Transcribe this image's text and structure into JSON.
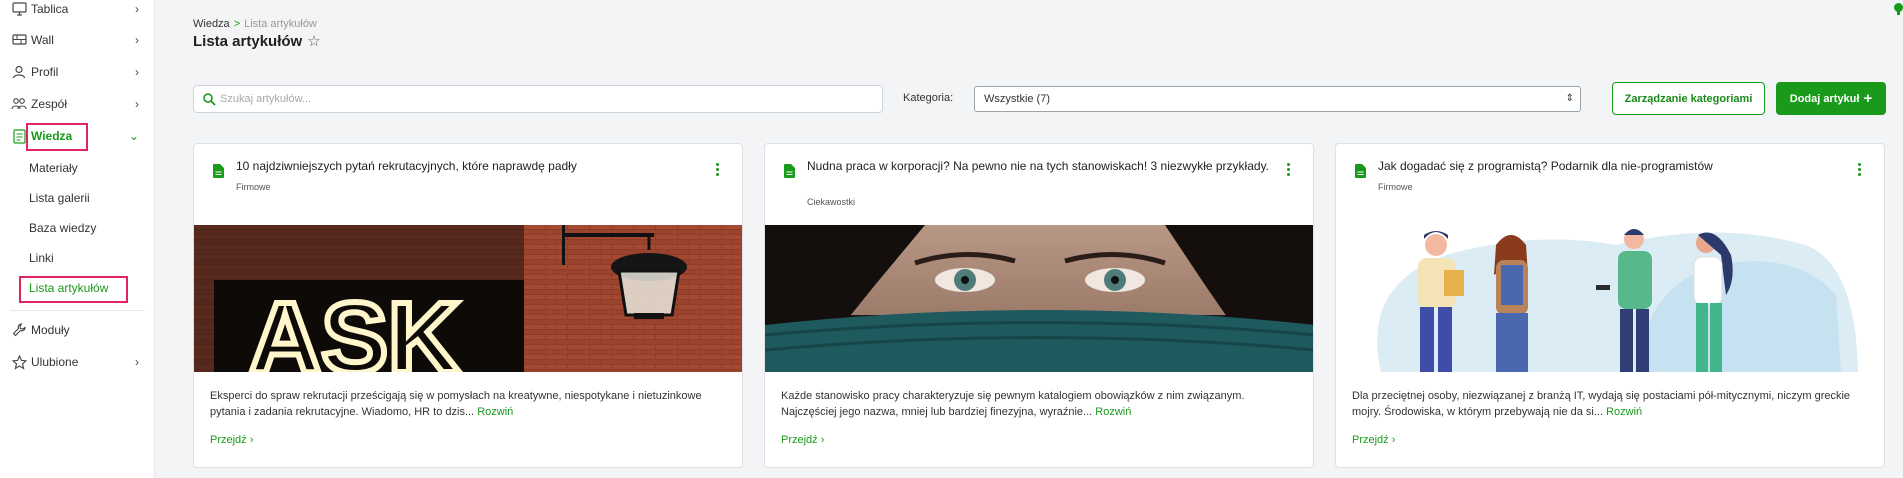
{
  "sidebar": {
    "items": [
      {
        "label": "Tablica",
        "icon": "monitor-icon"
      },
      {
        "label": "Wall",
        "icon": "wall-icon"
      },
      {
        "label": "Profil",
        "icon": "user-icon"
      },
      {
        "label": "Zespół",
        "icon": "team-icon"
      },
      {
        "label": "Wiedza",
        "icon": "knowledge-icon"
      },
      {
        "label": "Moduły",
        "icon": "wrench-icon"
      },
      {
        "label": "Ulubione",
        "icon": "star-icon"
      }
    ],
    "sub_items": [
      "Materiały",
      "Lista galerii",
      "Baza wiedzy",
      "Linki",
      "Lista artykułów"
    ],
    "expanded_chevron": "⌄",
    "collapsed_chevron": "›"
  },
  "header": {
    "breadcrumb": {
      "parent": "Wiedza",
      "separator": ">",
      "current": "Lista artykułów"
    },
    "title": "Lista artykułów"
  },
  "toolbar": {
    "search_placeholder": "Szukaj artykułów...",
    "category_label": "Kategoria:",
    "category_selected": "Wszystkie (7)",
    "manage_label": "Zarządzanie kategoriami",
    "add_label": "Dodaj artykuł",
    "add_icon": "+"
  },
  "articles": [
    {
      "title": "10 najdziwniejszych pytań rekrutacyjnych, które naprawdę padły",
      "category": "Firmowe",
      "excerpt": "Eksperci do spraw rekrutacji prześcigają się w pomysłach na kreatywne, niespotykane i nietuzinkowe pytania i zadania rekrutacyjne. Wiadomo, HR to dzis...",
      "more": "Rozwiń",
      "go": "Przejdź",
      "image_text": "ASK"
    },
    {
      "title": "Nudna praca w korporacji? Na pewno nie na tych stanowiskach! 3 niezwykłe przykłady.",
      "category": "Ciekawostki",
      "excerpt": "Każde stanowisko pracy charakteryzuje się pewnym katalogiem obowiązków z nim związanym. Najczęściej jego nazwa, mniej lub bardziej finezyjna, wyraźnie...",
      "more": "Rozwiń",
      "go": "Przejdź"
    },
    {
      "title": "Jak dogadać się z programistą? Podarnik dla nie-programistów",
      "category": "Firmowe",
      "excerpt": "Dla przeciętnej osoby, niezwiązanej z branżą IT, wydają się postaciami pół-mitycznymi, niczym greckie mojry. Środowiska, w którym przebywają nie da si...",
      "more": "Rozwiń",
      "go": "Przejdź"
    }
  ],
  "colors": {
    "accent": "#1a9a1a",
    "highlight": "#e0245e"
  }
}
